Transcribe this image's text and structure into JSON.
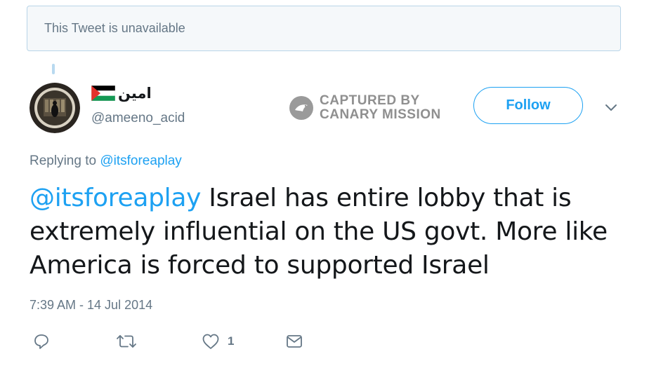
{
  "unavailable_notice": "This Tweet is unavailable",
  "author": {
    "display_name": "امين",
    "handle": "@ameeno_acid",
    "flag": "palestine-flag"
  },
  "watermark": {
    "line1": "CAPTURED BY",
    "line2": "CANARY MISSION"
  },
  "follow_label": "Follow",
  "replying": {
    "prefix": "Replying to",
    "handle": "@itsforeaplay"
  },
  "tweet": {
    "mention": "@itsforeaplay",
    "body": " Israel has entire lobby that is extremely influential on the US govt. More like America is forced to supported Israel"
  },
  "timestamp": "7:39 AM - 14 Jul 2014",
  "actions": {
    "reply_icon": "reply-icon",
    "retweet_icon": "retweet-icon",
    "like_icon": "heart-icon",
    "like_count": "1",
    "message_icon": "envelope-icon"
  },
  "colors": {
    "link_blue": "#1da1f2",
    "muted_gray": "#657786",
    "text_dark": "#14171a"
  }
}
